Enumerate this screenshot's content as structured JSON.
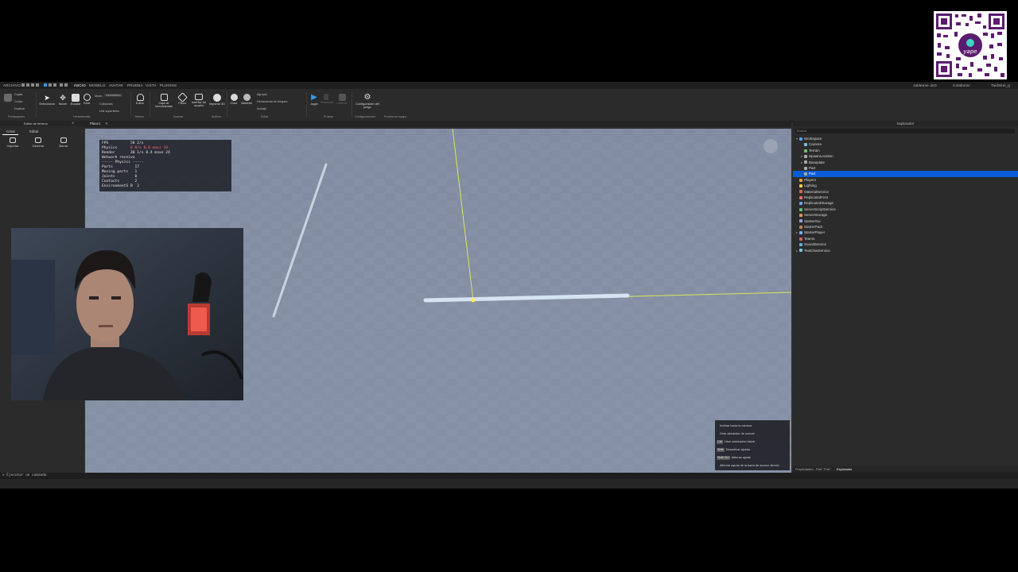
{
  "menu": {
    "file": "ARCHIVO",
    "tabs": [
      "INICIO",
      "MODELO",
      "AVATAR",
      "PRUEBA",
      "VISTA",
      "PLUGINS"
    ],
    "active_tab": "INICIO",
    "right_items": [
      "Jaldeene dsG",
      "Colaborar",
      "TaidSkel_g"
    ]
  },
  "ribbon": {
    "clipboard": {
      "paste": "",
      "copy": "Copiar",
      "cut": "Cortar",
      "duplicate": "Duplicar",
      "group_label": "Portapapeles"
    },
    "tools": {
      "select": "Seleccionar",
      "move": "Mover",
      "scale": "Escalar",
      "rotate": "Girar",
      "mode_label": "Modo:",
      "mode_value": "Geométrico",
      "collisions": "Colisiones",
      "join": "Unir superficies",
      "group_label": "Herramientas"
    },
    "terrain": {
      "editor": "Editor",
      "group_label": "Terreno"
    },
    "insert": {
      "toolbox": "Caja de herramientas",
      "part": "Pieza",
      "ui": "Interfaz de usuario",
      "import3d": "Importar 3D",
      "group_label": "Insertar"
    },
    "file_group": {
      "label": "Archivo"
    },
    "edit": {
      "color": "Color",
      "material": "Material",
      "group": "Agrupar",
      "lock": "Herramienta de bloqueo",
      "anchor": "Anclaje",
      "group_label": "Editar"
    },
    "test": {
      "play": "Jugar",
      "resume": "Reanudar",
      "stop": "Detener",
      "group_label": "Prueba"
    },
    "settings": {
      "game_settings": "Configuración del juego",
      "group_label": "Configuraciones",
      "team_test": "Prueba de equipo"
    }
  },
  "left_panel": {
    "title": "Editor de terreno",
    "tabs": [
      "Crear",
      "Editar"
    ],
    "buttons": [
      "Importar",
      "Generar",
      "Borrar"
    ]
  },
  "viewport": {
    "tab": "Place1"
  },
  "stats": [
    {
      "label": "FPS",
      "value": "58 2/s"
    },
    {
      "label": "Physics",
      "value": "0 0/s 0.0 maxi 19",
      "red": true
    },
    {
      "label": "Render",
      "value": "30 1/s 0.4 maxe 24"
    },
    {
      "label": "Network receive",
      "value": ""
    },
    {
      "label": "----- Physics -----",
      "value": ""
    },
    {
      "label": "Parts",
      "value": "17"
    },
    {
      "label": "Moving parts",
      "value": "1"
    },
    {
      "label": "Joints",
      "value": "0"
    },
    {
      "label": "Contacts",
      "value": "2"
    },
    {
      "label": "EnvironmentS B",
      "value": "2"
    }
  ],
  "hints": [
    {
      "key": "",
      "text": "Inclinar hacia la cámara"
    },
    {
      "key": "",
      "text": "Girar alrededor de normal"
    },
    {
      "key": "Ctrl",
      "text": "Usar orientación inicial"
    },
    {
      "key": "Shift",
      "text": "Desactivar ajustar"
    },
    {
      "key": "Shift Ctrl",
      "text": "Alternar ajuste"
    },
    {
      "key": "",
      "text": "Alternar ayuda de la barra de acceso directo"
    }
  ],
  "explorer": {
    "title": "Explorador",
    "filter_placeholder": "Buscar",
    "items": [
      {
        "label": "Workspace",
        "level": 0,
        "arrow": "▾",
        "color": "#5aa0e6"
      },
      {
        "label": "Camera",
        "level": 1,
        "arrow": "",
        "color": "#7ac0e0"
      },
      {
        "label": "Terrain",
        "level": 1,
        "arrow": "",
        "color": "#6cc070"
      },
      {
        "label": "SpawnLocation",
        "level": 1,
        "arrow": "▸",
        "color": "#aaaaaa"
      },
      {
        "label": "Baseplate",
        "level": 1,
        "arrow": "▸",
        "color": "#aaaaaa"
      },
      {
        "label": "Part",
        "level": 1,
        "arrow": "",
        "color": "#aaaaaa"
      },
      {
        "label": "Part",
        "level": 1,
        "arrow": "",
        "color": "#aaaaaa",
        "selected": true
      },
      {
        "label": "Players",
        "level": 0,
        "arrow": "",
        "color": "#e0a040"
      },
      {
        "label": "Lighting",
        "level": 0,
        "arrow": "",
        "color": "#f0d040"
      },
      {
        "label": "MaterialService",
        "level": 0,
        "arrow": "",
        "color": "#d07050"
      },
      {
        "label": "ReplicatedFirst",
        "level": 0,
        "arrow": "",
        "color": "#e07070"
      },
      {
        "label": "ReplicatedStorage",
        "level": 0,
        "arrow": "",
        "color": "#70a0e0"
      },
      {
        "label": "ServerScriptService",
        "level": 0,
        "arrow": "",
        "color": "#60c080"
      },
      {
        "label": "ServerStorage",
        "level": 0,
        "arrow": "",
        "color": "#e09060"
      },
      {
        "label": "StarterGui",
        "level": 0,
        "arrow": "",
        "color": "#a0a0e0"
      },
      {
        "label": "StarterPack",
        "level": 0,
        "arrow": "",
        "color": "#c08050"
      },
      {
        "label": "StarterPlayer",
        "level": 0,
        "arrow": "▸",
        "color": "#70b0e0"
      },
      {
        "label": "Teams",
        "level": 0,
        "arrow": "",
        "color": "#d06060"
      },
      {
        "label": "SoundService",
        "level": 0,
        "arrow": "",
        "color": "#60b0d0"
      },
      {
        "label": "TextChatService",
        "level": 0,
        "arrow": "▸",
        "color": "#80c0e0"
      }
    ],
    "bottom_tabs": [
      "Propiedades - Part \"Part\"",
      "Explorador"
    ]
  },
  "command_bar": {
    "placeholder": "Ejecutar un comando"
  },
  "colors": {
    "selection": "#0b5cd6",
    "play": "#2e9bf0",
    "viewport_sky": "#8591a6"
  }
}
